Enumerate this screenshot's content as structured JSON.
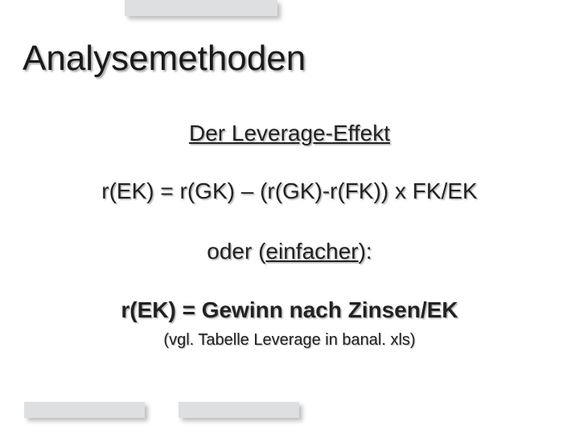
{
  "slide": {
    "title": "Analysemethoden",
    "subtitle": "Der Leverage-Effekt",
    "formula1": "r(EK) = r(GK) – (r(GK)-r(FK)) x FK/EK",
    "or_prefix": "oder (",
    "or_emph": "einfacher",
    "or_suffix": "):",
    "formula2": "r(EK) = Gewinn nach Zinsen/EK",
    "note": "(vgl. Tabelle Leverage in banal. xls)"
  }
}
